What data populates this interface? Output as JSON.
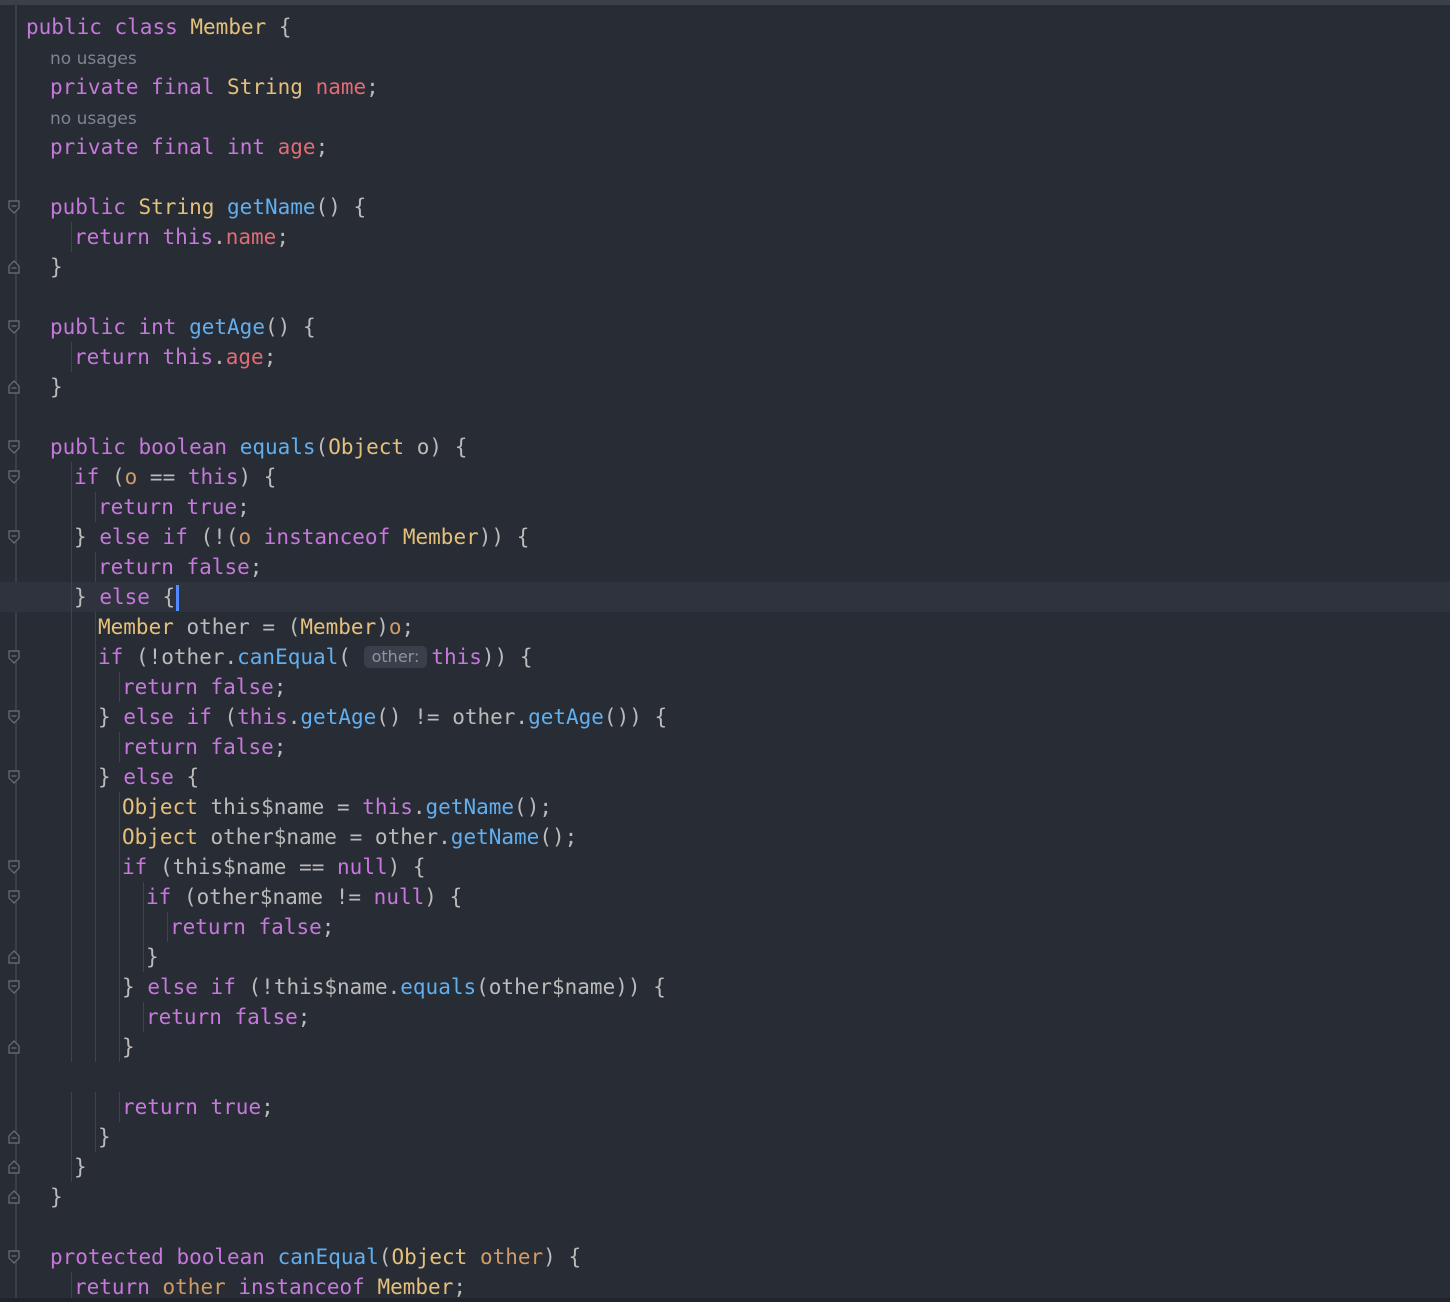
{
  "editor": {
    "language": "java",
    "caret_line": 19,
    "inlay_hint_text": "other:",
    "usage_hint_text": "no usages"
  },
  "lines": [
    "public class Member {",
    "no usages",
    "    private final String name;",
    "no usages",
    "    private final int age;",
    "",
    "    public String getName() {",
    "        return this.name;",
    "    }",
    "",
    "    public int getAge() {",
    "        return this.age;",
    "    }",
    "",
    "    public boolean equals(Object o) {",
    "        if (o == this) {",
    "            return true;",
    "        } else if (!(o instanceof Member)) {",
    "            return false;",
    "        } else {",
    "            Member other = (Member)o;",
    "            if (!other.canEqual( other: this)) {",
    "                return false;",
    "            } else if (this.getAge() != other.getAge()) {",
    "                return false;",
    "            } else {",
    "                Object this$name = this.getName();",
    "                Object other$name = other.getName();",
    "                if (this$name == null) {",
    "                    if (other$name != null) {",
    "                        return false;",
    "                    }",
    "                } else if (!this$name.equals(other$name)) {",
    "                    return false;",
    "                }",
    "",
    "                return true;",
    "            }",
    "        }",
    "    }",
    "",
    "    protected boolean canEqual(Object other) {",
    "        return other instanceof Member;"
  ],
  "theme": {
    "background": "#282c34",
    "keyword": "#c678dd",
    "type": "#e5c07b",
    "function": "#61afef",
    "field": "#e06c75",
    "parameter": "#d19a66",
    "text": "#bbbbbb",
    "hint": "#7f848e",
    "caret": "#528bff",
    "current_line": "#2f333d"
  }
}
